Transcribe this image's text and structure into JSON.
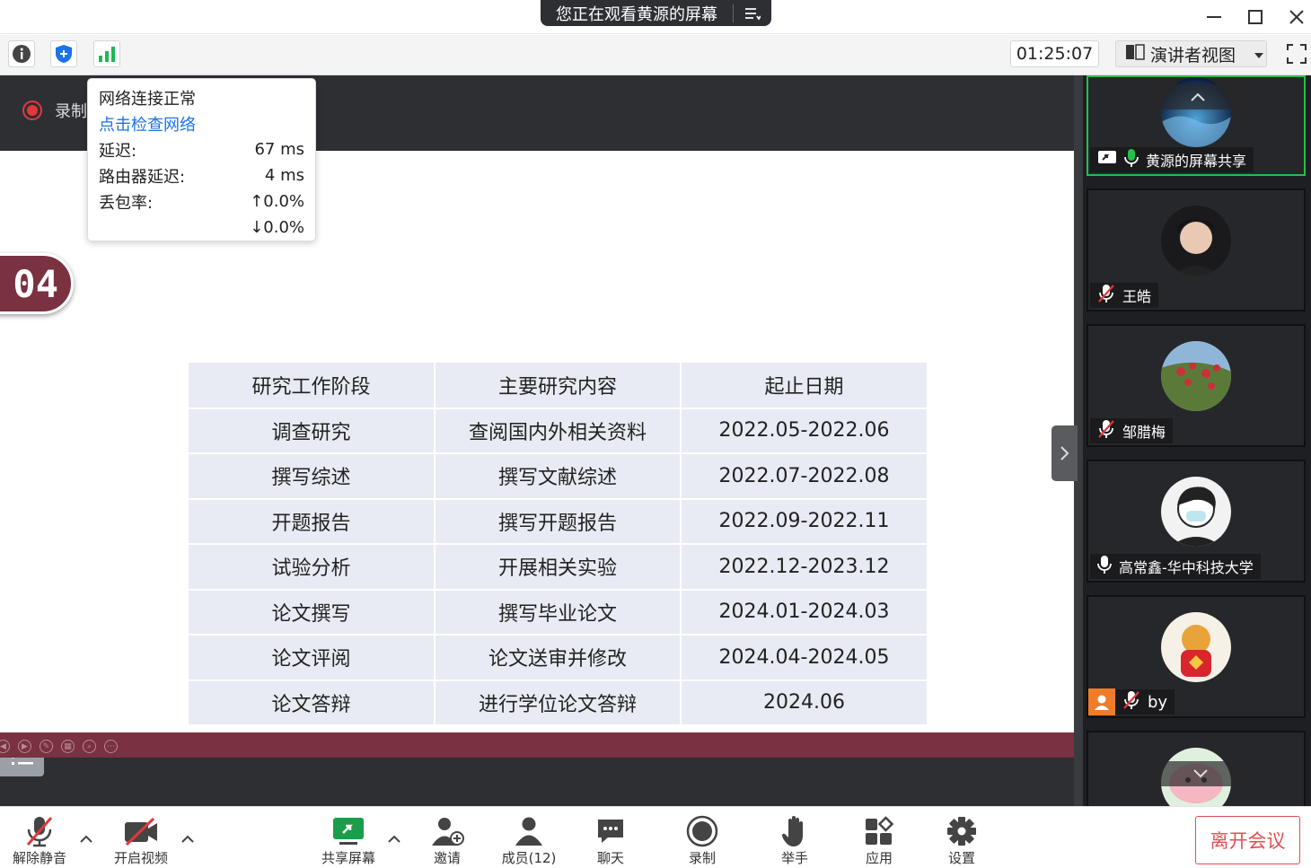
{
  "titlebar": {
    "viewing_text": "您正在观看黄源的屏幕"
  },
  "toolbar": {
    "timer": "01:25:07",
    "view_mode": "演讲者视图"
  },
  "recording": {
    "label": "录制"
  },
  "network": {
    "status": "网络连接正常",
    "check_link": "点击检查网络",
    "latency_label": "延迟:",
    "latency_value": "67 ms",
    "router_label": "路由器延迟:",
    "router_value": "4 ms",
    "loss_label": "丢包率:",
    "loss_up": "↑0.0%",
    "loss_down": "↓0.0%"
  },
  "slide": {
    "section_number": "04",
    "table": {
      "headers": [
        "研究工作阶段",
        "主要研究内容",
        "起止日期"
      ],
      "rows": [
        [
          "调查研究",
          "查阅国内外相关资料",
          "2022.05-2022.06"
        ],
        [
          "撰写综述",
          "撰写文献综述",
          "2022.07-2022.08"
        ],
        [
          "开题报告",
          "撰写开题报告",
          "2022.09-2022.11"
        ],
        [
          "试验分析",
          "开展相关实验",
          "2022.12-2023.12"
        ],
        [
          "论文撰写",
          "撰写毕业论文",
          "2024.01-2024.03"
        ],
        [
          "论文评阅",
          "论文送审并修改",
          "2024.04-2024.05"
        ],
        [
          "论文答辩",
          "进行学位论文答辩",
          "2024.06"
        ]
      ]
    }
  },
  "participants": [
    {
      "name": "黄源的屏幕共享",
      "mic": "on",
      "active": true
    },
    {
      "name": "王皓",
      "mic": "muted"
    },
    {
      "name": "邹腊梅",
      "mic": "muted"
    },
    {
      "name": "高常鑫-华中科技大学",
      "mic": "on"
    },
    {
      "name": "by",
      "mic": "muted"
    }
  ],
  "bottombar": {
    "unmute": "解除静音",
    "start_video": "开启视频",
    "share_screen": "共享屏幕",
    "invite": "邀请",
    "members": "成员(12)",
    "chat": "聊天",
    "record": "录制",
    "raise_hand": "举手",
    "apps": "应用",
    "settings": "设置",
    "leave": "离开会议"
  },
  "colors": {
    "accent_green": "#23c04a",
    "slide_maroon": "#7a3140",
    "leave_red": "#e14e50",
    "link_blue": "#1a73e8"
  }
}
